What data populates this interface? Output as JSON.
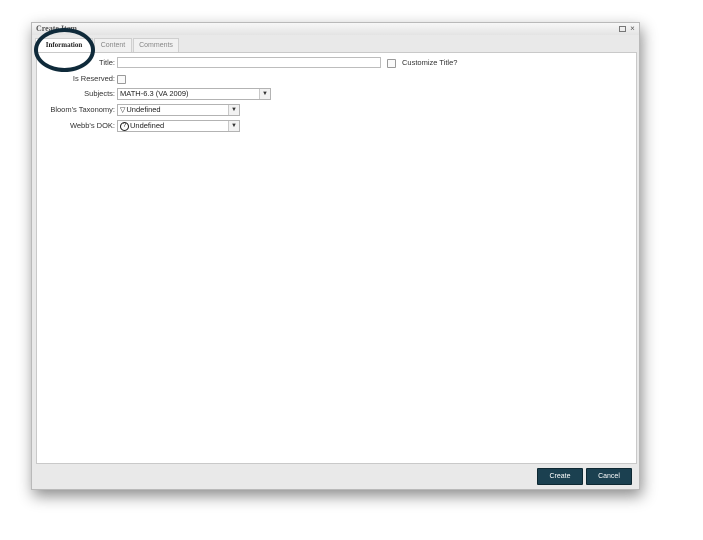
{
  "dialog": {
    "title": "Create Item",
    "maximize_glyph": "□",
    "close_glyph": "×"
  },
  "tabs": [
    {
      "label": "Information",
      "active": true
    },
    {
      "label": "Content",
      "active": false
    },
    {
      "label": "Comments",
      "active": false
    }
  ],
  "form": {
    "title": {
      "label": "Title:",
      "value": "",
      "customize_label": "Customize Title?",
      "customize_checked": false
    },
    "is_reserved": {
      "label": "Is Reserved:",
      "checked": false
    },
    "subjects": {
      "label": "Subjects:",
      "value": "MATH-6.3 (VA 2009)"
    },
    "blooms": {
      "label": "Bloom's Taxonomy:",
      "value": "Undefined",
      "icon": "pyramid-icon",
      "icon_glyph": "▽"
    },
    "webbs": {
      "label": "Webb's DOK:",
      "value": "Undefined",
      "icon": "question-circle-icon",
      "icon_glyph": "?"
    }
  },
  "footer": {
    "create_label": "Create",
    "cancel_label": "Cancel"
  },
  "colors": {
    "button_bg": "#1b4050",
    "highlight_circle": "#0f2a3a"
  }
}
